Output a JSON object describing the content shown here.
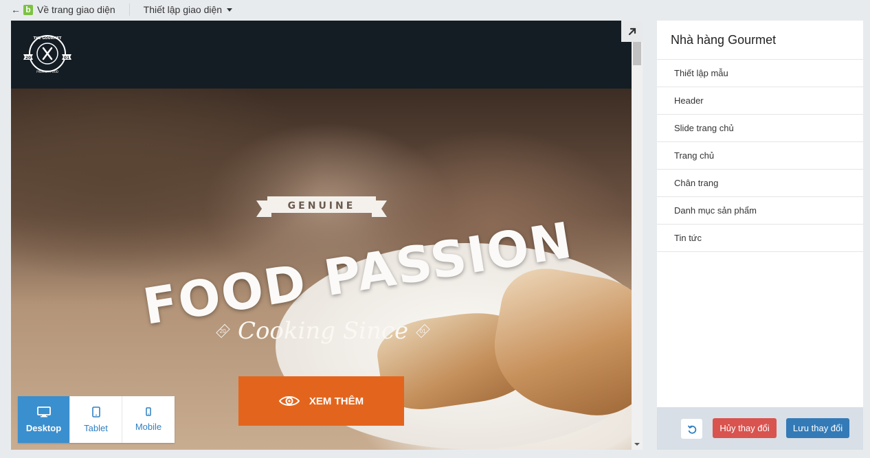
{
  "topbar": {
    "back_label": "Về trang giao diện",
    "logo_letter": "b",
    "settings_label": "Thiết lập giao diện"
  },
  "preview": {
    "logo": {
      "top_text": "THE GOURMET",
      "bottom_text": "PREMIUM FOOD",
      "left_num": "20",
      "right_num": "01"
    },
    "hero": {
      "badge": "GENUINE",
      "title": "FOOD PASSION",
      "subtitle_left": "20",
      "subtitle_script": "Cooking Since",
      "subtitle_right": "01",
      "cta_label": "XEM THÊM"
    },
    "devices": [
      {
        "label": "Desktop",
        "icon": "desktop-icon",
        "active": true
      },
      {
        "label": "Tablet",
        "icon": "tablet-icon",
        "active": false
      },
      {
        "label": "Mobile",
        "icon": "mobile-icon",
        "active": false
      }
    ]
  },
  "panel": {
    "title": "Nhà hàng Gourmet",
    "items": [
      {
        "label": "Thiết lập mẫu"
      },
      {
        "label": "Header"
      },
      {
        "label": "Slide trang chủ"
      },
      {
        "label": "Trang chủ"
      },
      {
        "label": "Chân trang"
      },
      {
        "label": "Danh mục sản phẩm"
      },
      {
        "label": "Tin tức"
      }
    ],
    "cancel_label": "Hủy thay đổi",
    "save_label": "Lưu thay đổi"
  },
  "colors": {
    "accent_orange": "#e3651d",
    "active_blue": "#3a8fcf",
    "cancel_red": "#d9534f",
    "save_blue": "#337ab7",
    "header_dark": "#151d24"
  }
}
